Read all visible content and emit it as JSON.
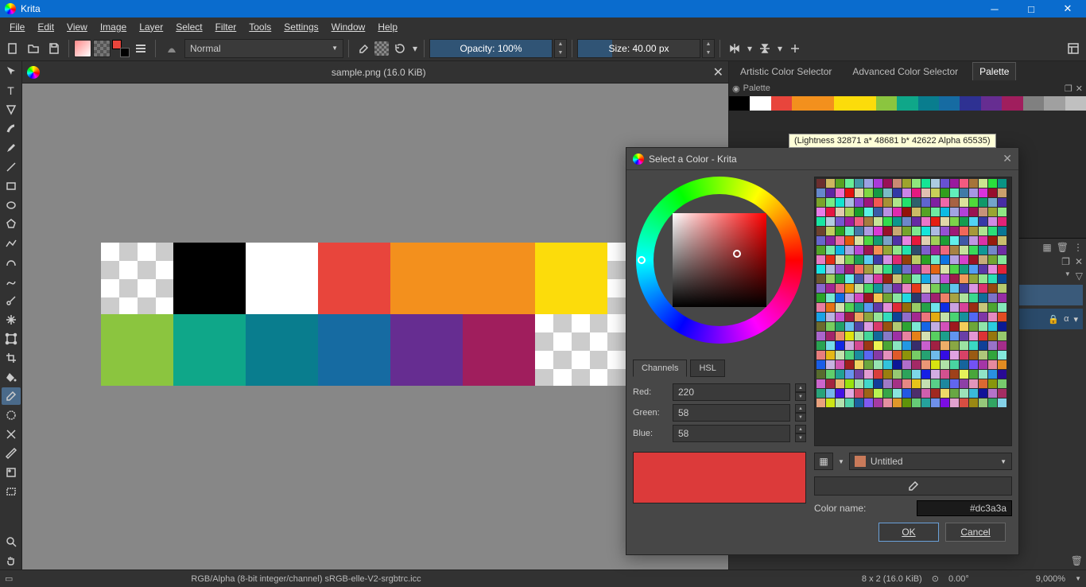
{
  "app": {
    "title": "Krita"
  },
  "menu": [
    "File",
    "Edit",
    "View",
    "Image",
    "Layer",
    "Select",
    "Filter",
    "Tools",
    "Settings",
    "Window",
    "Help"
  ],
  "toolbar": {
    "blend_mode": "Normal",
    "opacity_label": "Opacity: 100%",
    "size_label": "Size: 40.00 px"
  },
  "document": {
    "tab_title": "sample.png (16.0 KiB)"
  },
  "canvas_swatches": {
    "row1": [
      "checker",
      "#000000",
      "#ffffff",
      "#e8453c",
      "#f3901d",
      "#f3901d",
      "#fcdc0b",
      "checker"
    ],
    "row2": [
      "#8bc53f",
      "#0fa789",
      "#097d8e",
      "#166ba2",
      "#662d91",
      "#a01e5d",
      "checker",
      "checker"
    ]
  },
  "right_panel": {
    "tabs": [
      "Artistic Color Selector",
      "Advanced Color Selector",
      "Palette"
    ],
    "active_tab": "Palette",
    "palette_title": "Palette",
    "palette_colors": [
      "#000000",
      "#ffffff",
      "#e8453c",
      "#f3901d",
      "#f3901d",
      "#fcdc0b",
      "#fcdc0b",
      "#8bc53f",
      "#0fa789",
      "#097d8e",
      "#166ba2",
      "#2e3192",
      "#662d91",
      "#a01e5d",
      "#808080",
      "#a0a0a0",
      "#c0c0c0"
    ]
  },
  "tooltip": "(Lightness 32871 a* 48681 b* 42622 Alpha 65535)",
  "dialog": {
    "title": "Select a Color - Krita",
    "channel_tabs": [
      "Channels",
      "HSL"
    ],
    "active_channel_tab": "Channels",
    "channels": {
      "red_label": "Red:",
      "red": "220",
      "green_label": "Green:",
      "green": "58",
      "blue_label": "Blue:",
      "blue": "58"
    },
    "palette_name": "Untitled",
    "color_name_label": "Color name:",
    "color_name": "#dc3a3a",
    "ok": "OK",
    "cancel": "Cancel",
    "preview_color": "#dc3a3a"
  },
  "status": {
    "colorspace": "RGB/Alpha (8-bit integer/channel)  sRGB-elle-V2-srgbtrc.icc",
    "dims": "8 x 2 (16.0 KiB)",
    "angle": "0.00°",
    "zoom": "9,000%"
  }
}
